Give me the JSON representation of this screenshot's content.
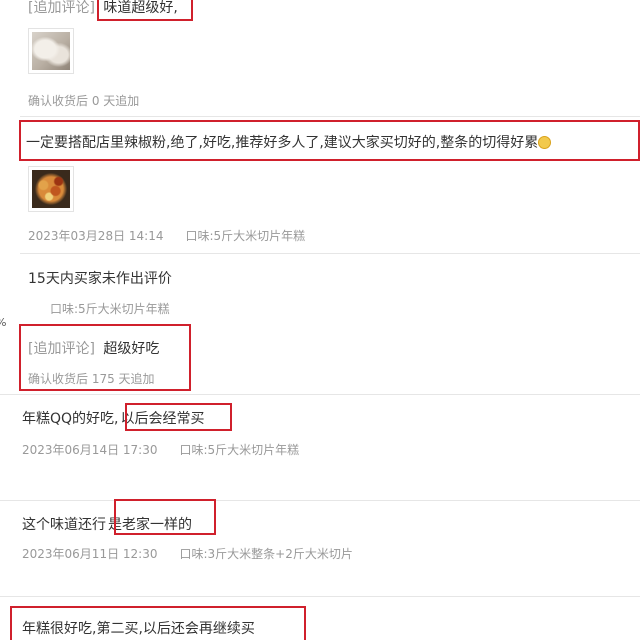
{
  "reviews": [
    {
      "add_tag": "[追加评论]",
      "add_text": "味道超级好,",
      "meta": "确认收货后 0 天追加"
    },
    {
      "text": "一定要搭配店里辣椒粉,绝了,好吃,推荐好多人了,建议大家买切好的,整条的切得好累",
      "date": "2023年03月28日 14:14",
      "spec": "口味:5斤大米切片年糕"
    },
    {
      "text": "15天内买家未作出评价",
      "spec": "口味:5斤大米切片年糕",
      "add_tag": "[追加评论]",
      "add_text": "超级好吃",
      "meta": "确认收货后 175 天追加"
    },
    {
      "text_a": "年糕QQ的好吃,",
      "text_b": "以后会经常买",
      "date": "2023年06月14日 17:30",
      "spec": "口味:5斤大米切片年糕"
    },
    {
      "text_a": "这个味道还行",
      "text_b": "是老家一样的",
      "date": "2023年06月11日 12:30",
      "spec": "口味:3斤大米整条+2斤大米切片"
    },
    {
      "text": "年糕很好吃,第二买,以后还会再继续买"
    }
  ],
  "edge_fragments": [
    "%",
    "%",
    ")"
  ],
  "colors": {
    "highlight": "#d0202c",
    "meta_text": "#999999",
    "main_text": "#333333",
    "divider": "#e6e6e6"
  },
  "icons": [
    "food-photo-thumbnail",
    "dish-photo-thumbnail",
    "smile-emoji-icon"
  ]
}
